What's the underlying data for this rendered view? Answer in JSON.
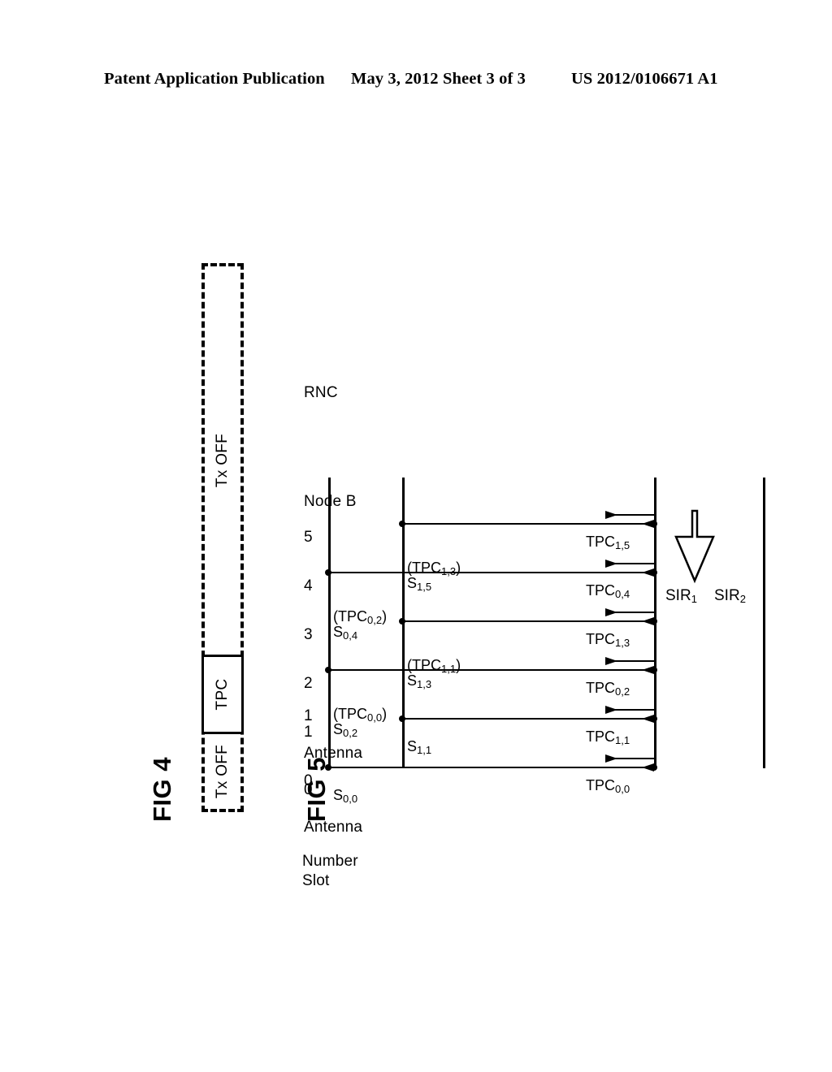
{
  "header": {
    "title": "Patent Application Publication",
    "date": "May 3, 2012",
    "sheet": "Sheet 3 of 3",
    "publication_number": "US 2012/0106671 A1"
  },
  "figures": [
    {
      "label": "FIG 4",
      "type": "slot-frame",
      "cells": [
        {
          "text": "Tx OFF",
          "boxed": false
        },
        {
          "text": "TPC",
          "boxed": true
        },
        {
          "text": "Tx OFF",
          "boxed": false
        }
      ]
    },
    {
      "label": "FIG 5",
      "type": "sequence-diagram",
      "slot_header_line1": "Slot",
      "slot_header_line2": "Number",
      "slot_numbers": [
        "0",
        "1",
        "2",
        "3",
        "4",
        "5"
      ],
      "actors": [
        {
          "id": "ant0",
          "name_line1": "Antenna",
          "name_line2": "0"
        },
        {
          "id": "ant1",
          "name_line1": "Antenna",
          "name_line2": "1"
        },
        {
          "id": "node",
          "name_line1": "Node B",
          "name_line2": ""
        },
        {
          "id": "rnc",
          "name_line1": "RNC",
          "name_line2": ""
        }
      ],
      "uplink_messages": [
        {
          "slot": "0",
          "from": "ant0",
          "to": "node",
          "paren": "",
          "main": "S",
          "sub": "0,0"
        },
        {
          "slot": "1",
          "from": "ant1",
          "to": "node",
          "paren": "",
          "main": "S",
          "sub": "1,1"
        },
        {
          "slot": "2",
          "from": "ant0",
          "to": "node",
          "paren": "(TPC",
          "paren_sub": "0,0",
          "paren_close": ")",
          "main": "S",
          "sub": "0,2"
        },
        {
          "slot": "3",
          "from": "ant1",
          "to": "node",
          "paren": "(TPC",
          "paren_sub": "1,1",
          "paren_close": ")",
          "main": "S",
          "sub": "1,3"
        },
        {
          "slot": "4",
          "from": "ant0",
          "to": "node",
          "paren": "(TPC",
          "paren_sub": "0,2",
          "paren_close": ")",
          "main": "S",
          "sub": "0,4"
        },
        {
          "slot": "5",
          "from": "ant1",
          "to": "node",
          "paren": "(TPC",
          "paren_sub": "1,3",
          "paren_close": ")",
          "main": "S",
          "sub": "1,5"
        }
      ],
      "downlink_messages": [
        {
          "slot": "0",
          "from": "node",
          "main": "TPC",
          "sub": "0,0"
        },
        {
          "slot": "1",
          "from": "node",
          "main": "TPC",
          "sub": "1,1"
        },
        {
          "slot": "2",
          "from": "node",
          "main": "TPC",
          "sub": "0,2"
        },
        {
          "slot": "3",
          "from": "node",
          "main": "TPC",
          "sub": "1,3"
        },
        {
          "slot": "4",
          "from": "node",
          "main": "TPC",
          "sub": "0,4"
        },
        {
          "slot": "5",
          "from": "node",
          "main": "TPC",
          "sub": "1,5"
        }
      ],
      "block_arrow": {
        "direction": "toward-node-b",
        "label_left_main": "SIR",
        "label_left_sub": "1",
        "label_right_main": "SIR",
        "label_right_sub": "2"
      }
    }
  ]
}
